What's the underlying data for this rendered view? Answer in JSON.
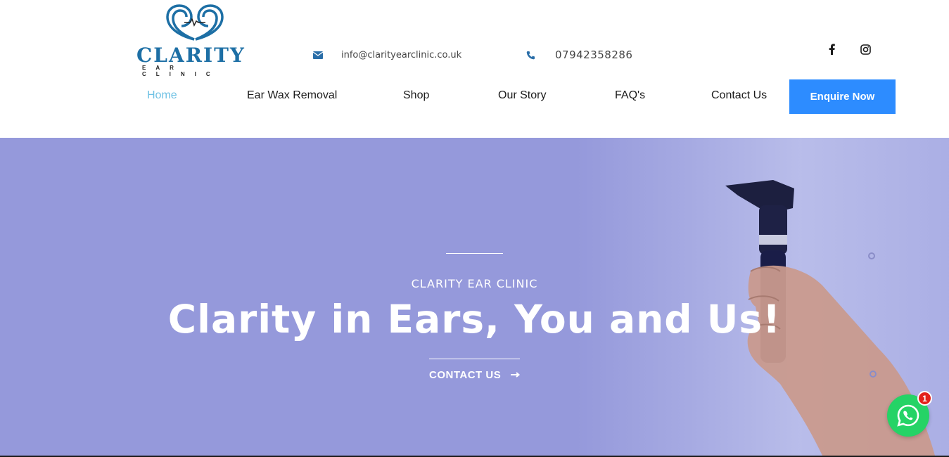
{
  "logo": {
    "word": "CLARITY",
    "sub": "EAR CLINIC"
  },
  "contact": {
    "email": "info@clarityearclinic.co.uk",
    "phone": "07942358286"
  },
  "social": {
    "facebook_icon": "facebook-icon",
    "instagram_icon": "instagram-icon"
  },
  "nav": {
    "items": [
      {
        "label": "Home",
        "active": true
      },
      {
        "label": "Ear Wax Removal"
      },
      {
        "label": "Shop"
      },
      {
        "label": "Our Story"
      },
      {
        "label": "FAQ's"
      },
      {
        "label": "Contact Us"
      }
    ],
    "cta": "Enquire Now"
  },
  "hero": {
    "kicker": "CLARITY EAR CLINIC",
    "title": "Clarity in Ears, You and Us!",
    "cta": "CONTACT US"
  },
  "whatsapp": {
    "badge": "1",
    "icon": "whatsapp-icon"
  },
  "colors": {
    "accent": "#2d8cff",
    "active_nav": "#6ec1e4",
    "hero_bg": "#9599db",
    "logo_blue": "#1d6fa5",
    "whatsapp": "#25d366",
    "badge": "#e3201b"
  }
}
